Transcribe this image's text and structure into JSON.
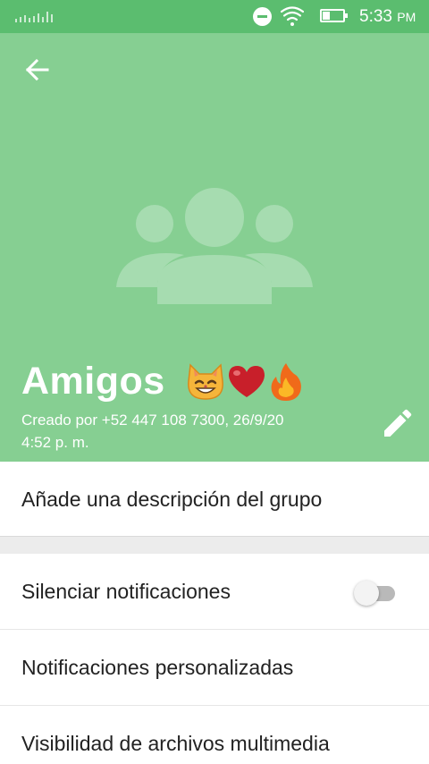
{
  "status_bar": {
    "time": "5:33",
    "ampm": "PM"
  },
  "group": {
    "name": "Amigos",
    "emojis": [
      "cat-smile-emoji",
      "heart-emoji",
      "fire-emoji"
    ],
    "created_line1": "Creado por +52 447 108 7300, 26/9/20",
    "created_line2": "4:52 p. m."
  },
  "description": {
    "placeholder": "Añade una descripción del grupo"
  },
  "settings": {
    "mute_label": "Silenciar notificaciones",
    "mute_enabled": false,
    "custom_notifications_label": "Notificaciones personalizadas",
    "media_visibility_label": "Visibilidad de archivos multimedia"
  },
  "colors": {
    "status_bar": "#5bbd6f",
    "header": "#86cf92",
    "accent": "#25d366"
  },
  "icons": {
    "back": "back-arrow-icon",
    "edit": "pencil-icon",
    "avatar": "group-placeholder-icon"
  }
}
